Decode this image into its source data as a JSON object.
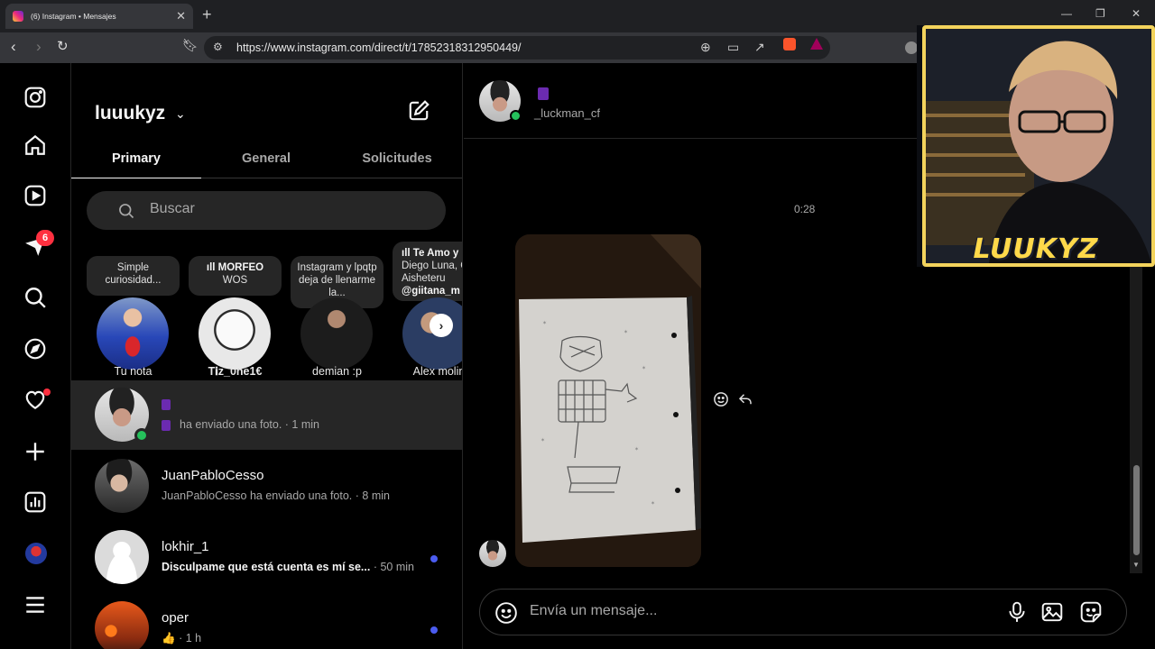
{
  "browser": {
    "tab_title": "(6) Instagram • Mensajes",
    "url": "https://www.instagram.com/direct/t/17852318312950449/"
  },
  "nav": {
    "notification_count": "6",
    "icons": [
      "instagram-icon",
      "home-icon",
      "reels-icon",
      "messages-icon",
      "search-icon",
      "explore-icon",
      "notifications-icon",
      "create-icon",
      "dashboard-icon",
      "profile-avatar",
      "more-icon"
    ]
  },
  "inbox": {
    "username": "luuukyz",
    "tabs": [
      {
        "label": "Primary"
      },
      {
        "label": "General"
      },
      {
        "label": "Solicitudes"
      }
    ],
    "search_placeholder": "Buscar",
    "notes": [
      {
        "text": "Simple curiosidad...",
        "name": "Tu nota"
      },
      {
        "text_title": "ıll MORFEO",
        "text": "WOS",
        "name": "T𝐢z_0ne1€"
      },
      {
        "text": "Instagram y lpqtp deja de llenarme la...",
        "name": "demian :p"
      },
      {
        "text_title": "ıll Te Amo y",
        "text": "Diego Luna, C Aisheteru",
        "text_extra": "@giitana_m",
        "name": "Alex molin"
      }
    ],
    "conversations": [
      {
        "name": "",
        "preview": "ha enviado una foto.",
        "time": "· 1 min",
        "selected": true,
        "online": true
      },
      {
        "name": "JuanPabloCesso",
        "preview": "JuanPabloCesso ha enviado una foto.",
        "time": "· 8 min"
      },
      {
        "name": "lokhir_1",
        "preview": "Disculpame que está cuenta es mí se...",
        "time": "· 50 min",
        "unread": true
      },
      {
        "name": "oper",
        "preview": "👍",
        "time": "· 1 h",
        "unread": true
      }
    ]
  },
  "chat": {
    "contact_handle": "_luckman_cf",
    "timestamp": "0:28",
    "composer_placeholder": "Envía un mensaje..."
  },
  "overlay": {
    "streamer_name": "LUUKYZ"
  },
  "colors": {
    "accent": "#0095f6",
    "badge": "#ff3040",
    "online": "#25c05b",
    "unread": "#4b5cf0",
    "cam_border": "#f3d35c"
  }
}
